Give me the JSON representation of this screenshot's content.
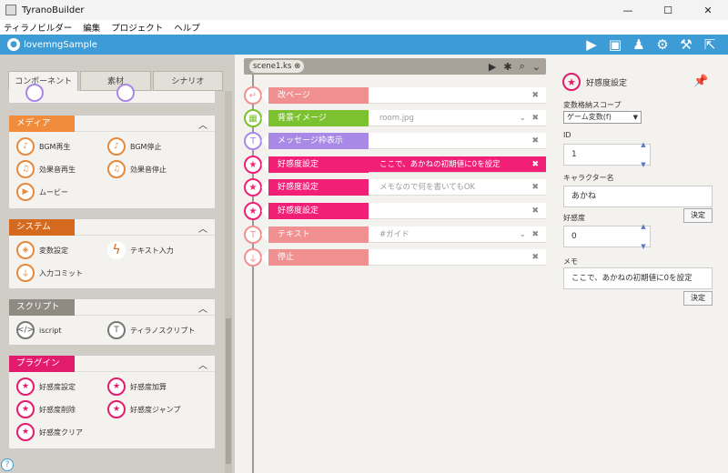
{
  "window": {
    "title": "TyranoBuilder",
    "minimize": "—",
    "maximize": "☐",
    "close": "✕"
  },
  "menu": [
    "ティラノビルダー",
    "編集",
    "プロジェクト",
    "ヘルプ"
  ],
  "toolbar": {
    "project_name": "lovemngSample",
    "icons": [
      "play-icon",
      "save-icon",
      "users-icon",
      "gear-icon",
      "hammer-icon",
      "share-icon"
    ]
  },
  "left": {
    "tabs": [
      "コンポーネント",
      "素材",
      "シナリオ"
    ],
    "categories": [
      {
        "label": "メディア",
        "color": "#f08c3c",
        "items": [
          "BGM再生",
          "BGM停止",
          "効果音再生",
          "効果音停止",
          "ムービー"
        ]
      },
      {
        "label": "システム",
        "color": "#d56a1f",
        "items": [
          "変数設定",
          "テキスト入力",
          "入力コミット"
        ]
      },
      {
        "label": "スクリプト",
        "color": "#8f8a82",
        "items": [
          "iscript",
          "ティラノスクリプト"
        ]
      },
      {
        "label": "プラグイン",
        "color": "#e31b6d",
        "items": [
          "好感度設定",
          "好感度加算",
          "好感度削除",
          "好感度ジャンプ",
          "好感度クリア"
        ]
      }
    ]
  },
  "scene": {
    "tab": "scene1.ks ⊗",
    "rows": [
      {
        "label": "改ページ",
        "value": "",
        "color": "#f09090"
      },
      {
        "label": "背景イメージ",
        "value": "room.jpg",
        "color": "#7cc230"
      },
      {
        "label": "メッセージ枠表示",
        "value": "",
        "color": "#a88ae6"
      },
      {
        "label": "好感度設定",
        "value": "ここで、あかねの初期値に0を設定",
        "color": "#f21f77"
      },
      {
        "label": "好感度設定",
        "value": "メモなので何を書いてもOK",
        "color": "#f21f77"
      },
      {
        "label": "好感度設定",
        "value": "",
        "color": "#f21f77"
      },
      {
        "label": "テキスト",
        "value": "#ガイド",
        "color": "#f09090"
      },
      {
        "label": "停止",
        "value": "",
        "color": "#f09090"
      }
    ]
  },
  "right": {
    "title": "好感度設定",
    "scope_label": "変数格納スコープ",
    "scope_value": "ゲーム変数(f)",
    "id_label": "ID",
    "id_value": "1",
    "char_label": "キャラクター名",
    "char_value": "あかね",
    "decide": "決定",
    "affinity_label": "好感度",
    "affinity_value": "0",
    "memo_label": "メモ",
    "memo_value": "ここで、あかねの初期値に0を設定"
  }
}
